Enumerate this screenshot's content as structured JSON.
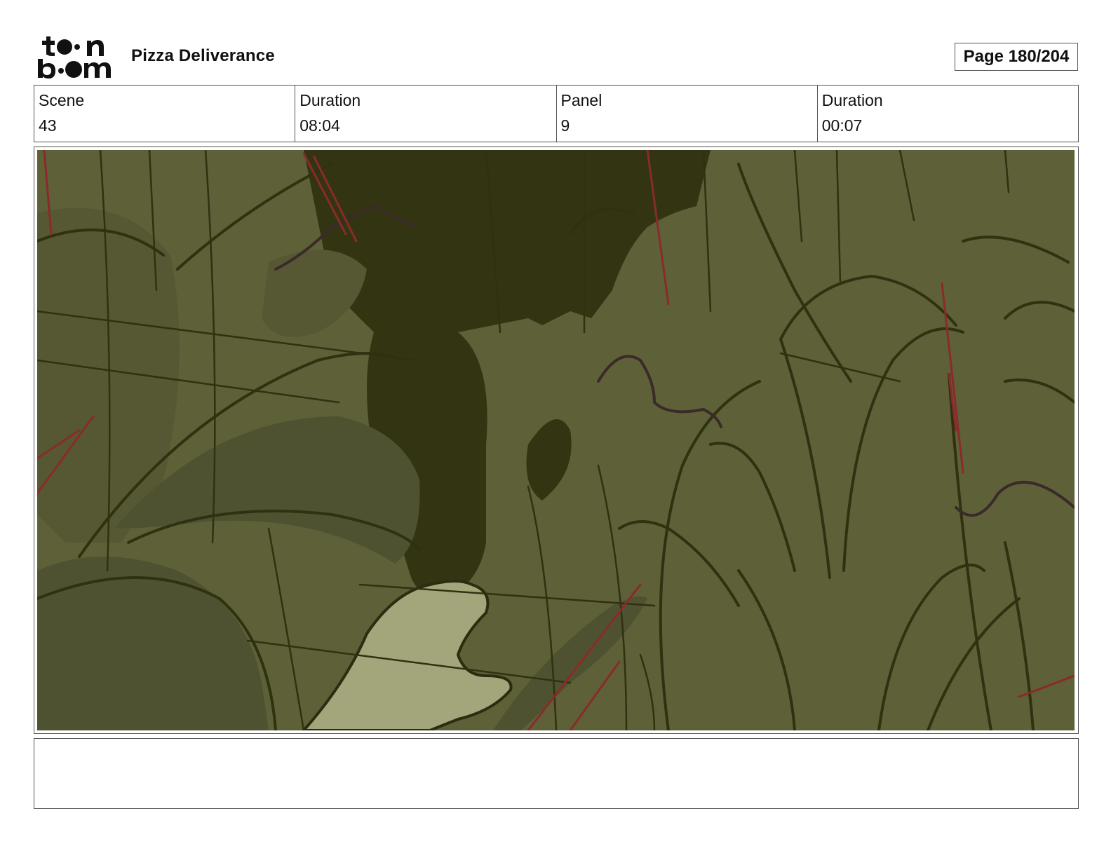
{
  "header": {
    "project_title": "Pizza Deliverance",
    "page_label": "Page 180/204"
  },
  "info": [
    {
      "label": "Scene",
      "value": "43"
    },
    {
      "label": "Duration",
      "value": "08:04"
    },
    {
      "label": "Panel",
      "value": "9"
    },
    {
      "label": "Duration",
      "value": "00:07"
    }
  ],
  "notes": {
    "text": ""
  },
  "colors": {
    "foliage_base": "#5e6038",
    "foliage_dark": "#333512",
    "leaf_mid": "#4f5230",
    "hand": "#a3a57b",
    "red_strokes": "#8a2a2a"
  },
  "icons": [
    "toonboom-logo"
  ]
}
